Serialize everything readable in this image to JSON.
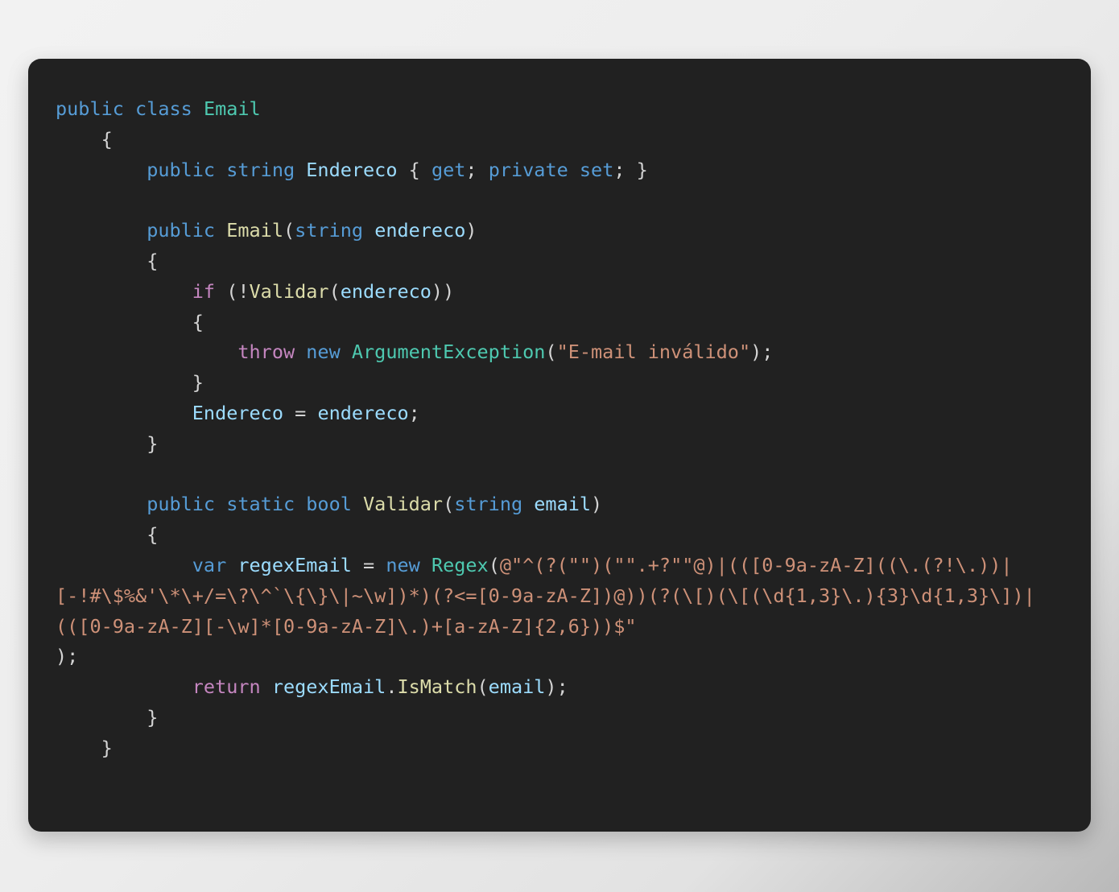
{
  "theme": {
    "page_background": "#ededed",
    "card_background": "#212121",
    "plain": "#d4d4d4",
    "keyword": "#569cd6",
    "control": "#c586c0",
    "type": "#4ec9b0",
    "function": "#dcdcaa",
    "variable": "#9cdcfe",
    "string": "#ce9178"
  },
  "code": {
    "language": "csharp",
    "lines": [
      {
        "n": 1,
        "text": "public class Email"
      },
      {
        "n": 2,
        "text": "    {"
      },
      {
        "n": 3,
        "text": "        public string Endereco { get; private set; }"
      },
      {
        "n": 4,
        "text": ""
      },
      {
        "n": 5,
        "text": "        public Email(string endereco)"
      },
      {
        "n": 6,
        "text": "        {"
      },
      {
        "n": 7,
        "text": "            if (!Validar(endereco))"
      },
      {
        "n": 8,
        "text": "            {"
      },
      {
        "n": 9,
        "text": "                throw new ArgumentException(\"E-mail inválido\");"
      },
      {
        "n": 10,
        "text": "            }"
      },
      {
        "n": 11,
        "text": "            Endereco = endereco;"
      },
      {
        "n": 12,
        "text": "        }"
      },
      {
        "n": 13,
        "text": ""
      },
      {
        "n": 14,
        "text": "        public static bool Validar(string email)"
      },
      {
        "n": 15,
        "text": "        {"
      },
      {
        "n": 16,
        "text": "            var regexEmail = new Regex(@\"^(?(\"\")(\"\".+?\"\"@)|((([0-9a-zA-Z]((\\.(?!\\.))|[-!#\\$%&'\\*\\+/=\\?\\^`\\{\\}\\|~\\w])*)(?<=[0-9a-zA-Z])@))(?(\\[)(\\[(\\d{1,3}\\.){3}\\d{1,3}\\])|((([0-9a-zA-Z][-\\w]*[0-9a-zA-Z]\\.)+[a-zA-Z]{2,6}))$\""
      },
      {
        "n": 17,
        "text": ");"
      },
      {
        "n": 18,
        "text": "            return regexEmail.IsMatch(email);"
      },
      {
        "n": 19,
        "text": "        }"
      },
      {
        "n": 20,
        "text": "    }"
      }
    ],
    "tokens": {
      "kw_public": "public",
      "kw_class": "class",
      "kw_string": "string",
      "kw_get": "get",
      "kw_private": "private",
      "kw_set": "set",
      "kw_static": "static",
      "kw_bool": "bool",
      "kw_var": "var",
      "kw_new": "new",
      "ctl_if": "if",
      "ctl_throw": "throw",
      "ctl_return": "return",
      "type_email": "Email",
      "type_argumentexception": "ArgumentException",
      "type_regex": "Regex",
      "fn_email_ctor": "Email",
      "fn_validar": "Validar",
      "fn_ismatch": "IsMatch",
      "var_endereco_prop": "Endereco",
      "var_endereco_param": "endereco",
      "var_email_param": "email",
      "var_regexemail": "regexEmail",
      "str_invalid_email": "\"E-mail inválido\"",
      "regex_part_1": "@\"^(?(\"\")(\"\".+?\"\"",
      "regex_part_2": "@)|(([0-9a-zA-Z]((\\.(?!\\.))|[-!#\\$%&'\\*\\+/=\\?\\^`\\{\\}\\|~\\w])*)(?<=[0-9a-zA-Z])@))",
      "regex_part_3": "(?(\\[)(\\[(\\d{1,3}\\.){3}\\d{1,3}\\])|(([0-9a-zA-Z][-\\w]*[0-9a-zA-Z]\\.)+[a-zA-Z]{2,",
      "regex_part_4": "6}))$\"",
      "close_paren_semicolon": ");"
    }
  }
}
